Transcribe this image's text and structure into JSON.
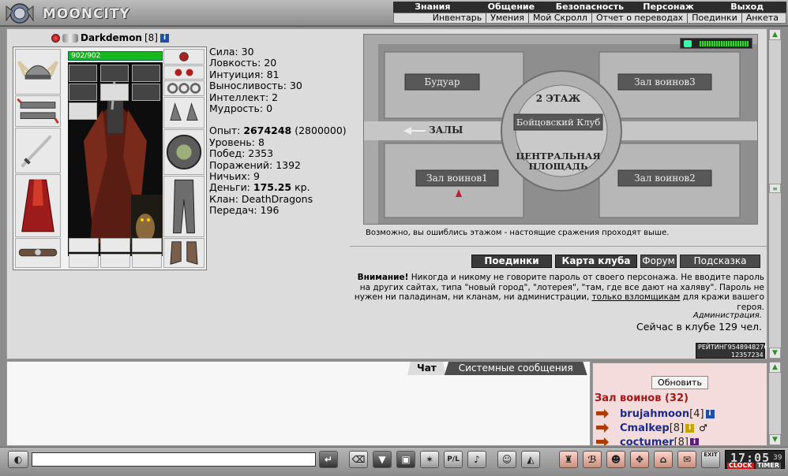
{
  "app": {
    "logo_text": "MOONCITY"
  },
  "topmenu": {
    "row1": [
      "Знания",
      "Общение",
      "Безопасность",
      "Персонаж",
      "Выход"
    ],
    "row2": [
      "Инвентарь",
      "Умения",
      "Мой Скролл",
      "Отчет о переводах",
      "Поединки",
      "Анкета"
    ]
  },
  "character": {
    "name": "Darkdemon",
    "level": "[8]",
    "info_icon": "i",
    "hp": "902/902",
    "hp_fraction": 1.0
  },
  "stats": {
    "strength": "Сила: 30",
    "agility": "Ловкость: 20",
    "intuition": "Интуиция: 81",
    "endurance": "Выносливость: 30",
    "intellect": "Интеллект: 2",
    "wisdom": "Мудрость: 0",
    "exp_label": "Опыт: ",
    "exp_value": "2674248",
    "exp_next": " (2800000)",
    "level": "Уровень: 8",
    "wins": "Побед: 2353",
    "losses": "Поражений: 1392",
    "draws": "Ничьих: 9",
    "money_label": "Деньги: ",
    "money_value": "175.25",
    "money_unit": " кр.",
    "clan": "Клан: DeathDragons",
    "transfers": "Передач: 196"
  },
  "location": {
    "rooms": {
      "boudoir": "Будуар",
      "hall3": "Зал воинов3",
      "floor2": "2 ЭТАЖ",
      "fight_club": "Бойцовский Клуб",
      "halls": "ЗАЛЫ",
      "central1": "ЦЕНТРАЛЬНАЯ",
      "central2": "ПЛОЩАДЬ",
      "hall1": "Зал воинов1",
      "hall2": "Зал воинов2"
    },
    "note": "Возможно, вы ошиблись этажом - настоящие сражения проходят выше."
  },
  "buttons": {
    "duels": "Поединки",
    "club_map": "Карта клуба",
    "forum": "Форум",
    "hint": "Подсказка"
  },
  "warning": {
    "title": "Внимание!",
    "text1": " Никогда и никому не говорите пароль от своего персонажа. Не вводите пароль на других сайтах, типа \"новый город\", \"лотерея\", \"там, где все дают на халяву\". Пароль не нужен ни паладинам, ни кланам, ни администрации, ",
    "link": "только взломщикам",
    "text2": " для кражи вашего героя.",
    "signature": "Администрация.",
    "online": "Сейчас в клубе 129 чел."
  },
  "rating": {
    "label": "РЕЙТИНГ",
    "value1": "9548948276",
    "value2": "12357234"
  },
  "chat": {
    "tab_chat": "Чат",
    "tab_system": "Системные сообщения"
  },
  "online_panel": {
    "refresh": "Обновить",
    "room": "Зал воинов (32)",
    "users": [
      {
        "nick": "brujahmoon",
        "level": "[4]"
      },
      {
        "nick": "Cmalkep",
        "level": "[8]"
      },
      {
        "nick": "coctumer",
        "level": "[8]"
      }
    ]
  },
  "clock": {
    "time": "17:05",
    "seconds": "39",
    "clock_label": "CLOCK",
    "timer_label": "TIMER"
  },
  "toolbar": {
    "exit_label": "EXIT",
    "pl_label": "P/L"
  },
  "colors": {
    "accent_dark": "#2c2c2c",
    "room_title": "#a01818",
    "nick": "#1c2c86",
    "hp_green": "#17b81f"
  }
}
